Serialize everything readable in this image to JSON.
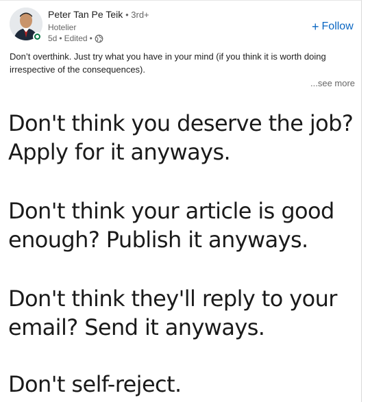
{
  "post": {
    "author": {
      "name": "Peter Tan Pe Teik",
      "degree": "• 3rd+",
      "headline": "Hotelier"
    },
    "meta": {
      "age": "5d",
      "dot1": "•",
      "edited": "Edited",
      "dot2": "•",
      "visibility_icon": "globe-icon"
    },
    "follow_label": "Follow",
    "follow_icon": "plus",
    "text": "Don’t overthink. Just try what you have in your mind (if you think it is worth doing irrespective of the consequences).",
    "see_more": "...see more"
  },
  "image_text": {
    "line1": "Don't think you deserve the job?",
    "line2": "Apply for it anyways.",
    "line3": "Don't think your article is good",
    "line4": "enough? Publish it anyways.",
    "line5": "Don't think they'll reply to your",
    "line6": "email? Send it anyways.",
    "line7": "Don't self-reject."
  },
  "colors": {
    "accent": "#0a66c2",
    "online": "#057642",
    "muted": "#666666"
  }
}
